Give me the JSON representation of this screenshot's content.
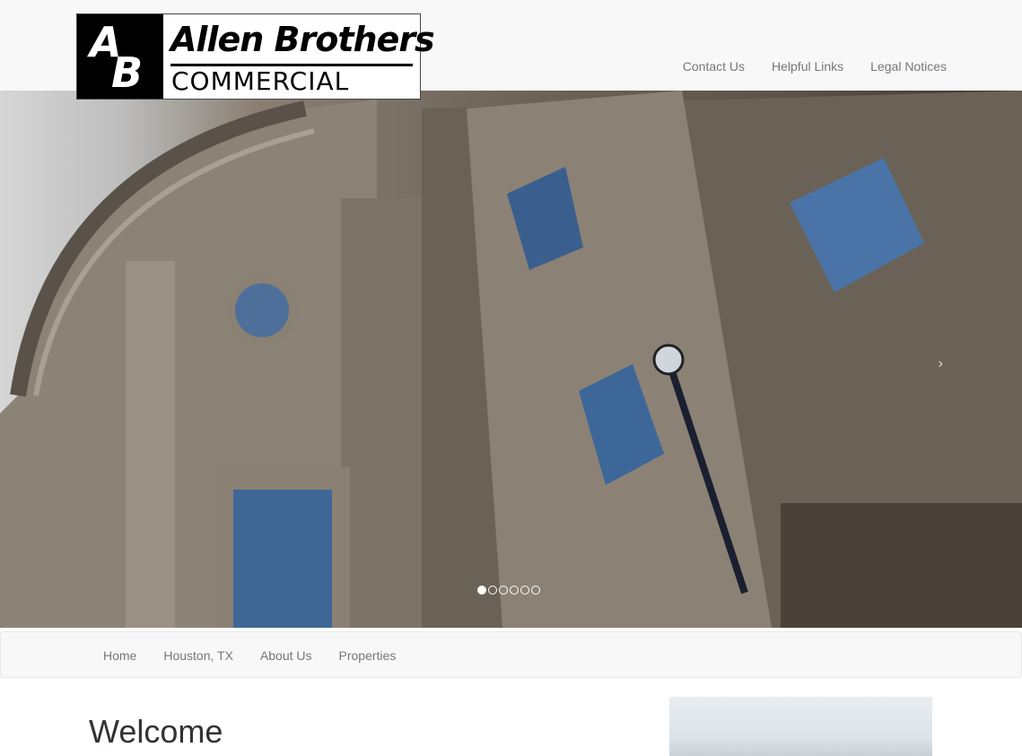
{
  "logo": {
    "initial_a": "A",
    "initial_b": "B",
    "title": "Allen Brothers",
    "subtitle": "COMMERCIAL"
  },
  "top_nav": [
    "Contact Us",
    "Helpful Links",
    "Legal Notices"
  ],
  "hero": {
    "slide_count": 6,
    "active_slide": 1,
    "next_glyph": "›"
  },
  "main_nav": [
    "Home",
    "Houston, TX",
    "About Us",
    "Properties"
  ],
  "content": {
    "heading": "Welcome"
  }
}
